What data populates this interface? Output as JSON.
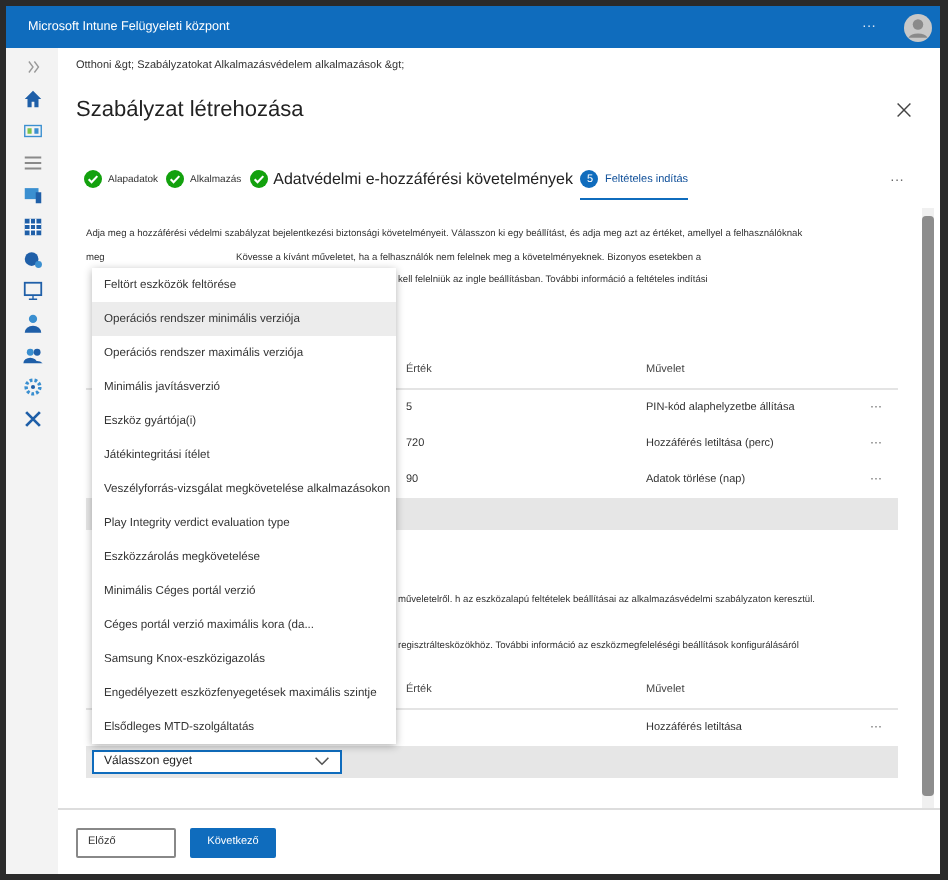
{
  "app_bar": {
    "title": "Microsoft Intune Felügyeleti központ",
    "more": "···"
  },
  "breadcrumb": "Otthoni &gt; Szabályzatokat Alkalmazásvédelem alkalmazások &gt;",
  "page_title": "Szabályzat létrehozása",
  "steps": [
    {
      "label": "Alapadatok",
      "kind": "done",
      "selected": false,
      "large": false
    },
    {
      "label": "Alkalmazás",
      "kind": "done",
      "selected": false,
      "large": false
    },
    {
      "label": "Adatvédelmi e-hozzáférési követelmények",
      "kind": "done",
      "selected": false,
      "large": true
    },
    {
      "number": "5",
      "label": "Feltételes indítás",
      "kind": "current",
      "selected": true,
      "large": false
    }
  ],
  "steps_more": "···",
  "description": [
    {
      "text": "Adja meg a hozzáférési védelmi szabályzat bejelentkezési biztonsági követelményeit. Válasszon ki egy beállítást, és adja meg azt az értéket, amellyel a felhasználóknak",
      "kind": "full"
    },
    {
      "text": "meg",
      "kind": "lead"
    },
    {
      "text": "Kövesse a kívánt műveletet, ha a felhasználók nem felelnek meg a követelményeknek. Bizonyos esetekben a",
      "kind": "tail"
    },
    {
      "text": "kell felelniük az ingle beállításban. További információ a feltételes indítási",
      "kind": "tail2"
    }
  ],
  "table_1": {
    "columns": [
      "Érték",
      "Művelet"
    ],
    "rows": [
      {
        "value": "5",
        "action": "PIN-kód alaphelyzetbe állítása",
        "more": "···"
      },
      {
        "value": "720",
        "action": "Hozzáférés letiltása (perc)",
        "more": "···"
      },
      {
        "value": "90",
        "action": "Adatok törlése (nap)",
        "more": "···"
      }
    ]
  },
  "section_2": [
    "műveletelről. h az eszközalapú feltételek beállításai az alkalmazásvédelmi szabályzaton keresztül.",
    "regisztráltesközökhöz. További információ az eszközmegfeleléségi beállítások konfigurálásáról"
  ],
  "table_2": {
    "columns": [
      "Érték",
      "Művelet"
    ],
    "rows": [
      {
        "action": "Hozzáférés letiltása",
        "more": "···"
      }
    ],
    "new_row": {
      "placeholder": "Válasszon egyet"
    }
  },
  "dropdown": [
    {
      "label": "Feltört eszközök feltörése",
      "selected": false
    },
    {
      "label": "Operációs rendszer minimális verziója",
      "selected": true
    },
    {
      "label": "Operációs rendszer maximális verziója",
      "selected": false
    },
    {
      "label": "Minimális javításverzió",
      "selected": false
    },
    {
      "label": "Eszköz gyártója(i)",
      "selected": false
    },
    {
      "label": "Játékintegritási ítélet",
      "selected": false
    },
    {
      "label": "Veszélyforrás-vizsgálat megkövetelése alkalmazásokon",
      "selected": false
    },
    {
      "label": "Play Integrity verdict evaluation type",
      "selected": false
    },
    {
      "label": "Eszközzárolás megkövetelése",
      "selected": false
    },
    {
      "label": "Minimális Céges portál verzió",
      "selected": false
    },
    {
      "label": "Céges portál verzió maximális kora (da...",
      "selected": false
    },
    {
      "label": "Samsung Knox-eszközigazolás",
      "selected": false
    },
    {
      "label": "Engedélyezett eszközfenyegetések maximális szintje",
      "selected": false
    },
    {
      "label": "Elsődleges MTD-szolgáltatás",
      "selected": false
    }
  ],
  "footer_buttons": [
    {
      "label": "Előző",
      "kind": "secondary"
    },
    {
      "label": "Következő",
      "kind": "primary"
    }
  ]
}
